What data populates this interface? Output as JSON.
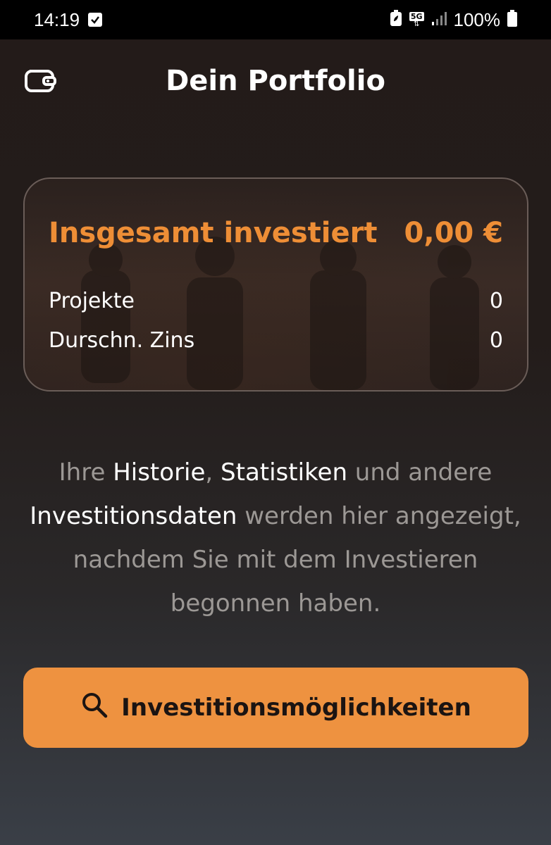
{
  "status_bar": {
    "time": "14:19",
    "network": "5G",
    "battery_percent": "100%"
  },
  "header": {
    "title": "Dein Portfolio",
    "left_icon": "wallet-icon"
  },
  "summary": {
    "total_label": "Insgesamt investiert",
    "total_value": "0,00 €",
    "rows": [
      {
        "label": "Projekte",
        "value": "0"
      },
      {
        "label": "Durschn. Zins",
        "value": "0"
      }
    ]
  },
  "info": {
    "part1": "Ihre ",
    "hl1": "Historie",
    "part2": ", ",
    "hl2": "Statistiken",
    "part3": " und andere ",
    "hl3": "Investitionsdaten",
    "part4": " werden hier angezeigt, nachdem Sie mit dem Investieren begonnen haben."
  },
  "cta": {
    "label": "Investitionsmöglichkeiten",
    "icon": "search-icon"
  },
  "colors": {
    "accent": "#ee9240",
    "accent_text": "#ee8e36",
    "background": "#231b19"
  }
}
